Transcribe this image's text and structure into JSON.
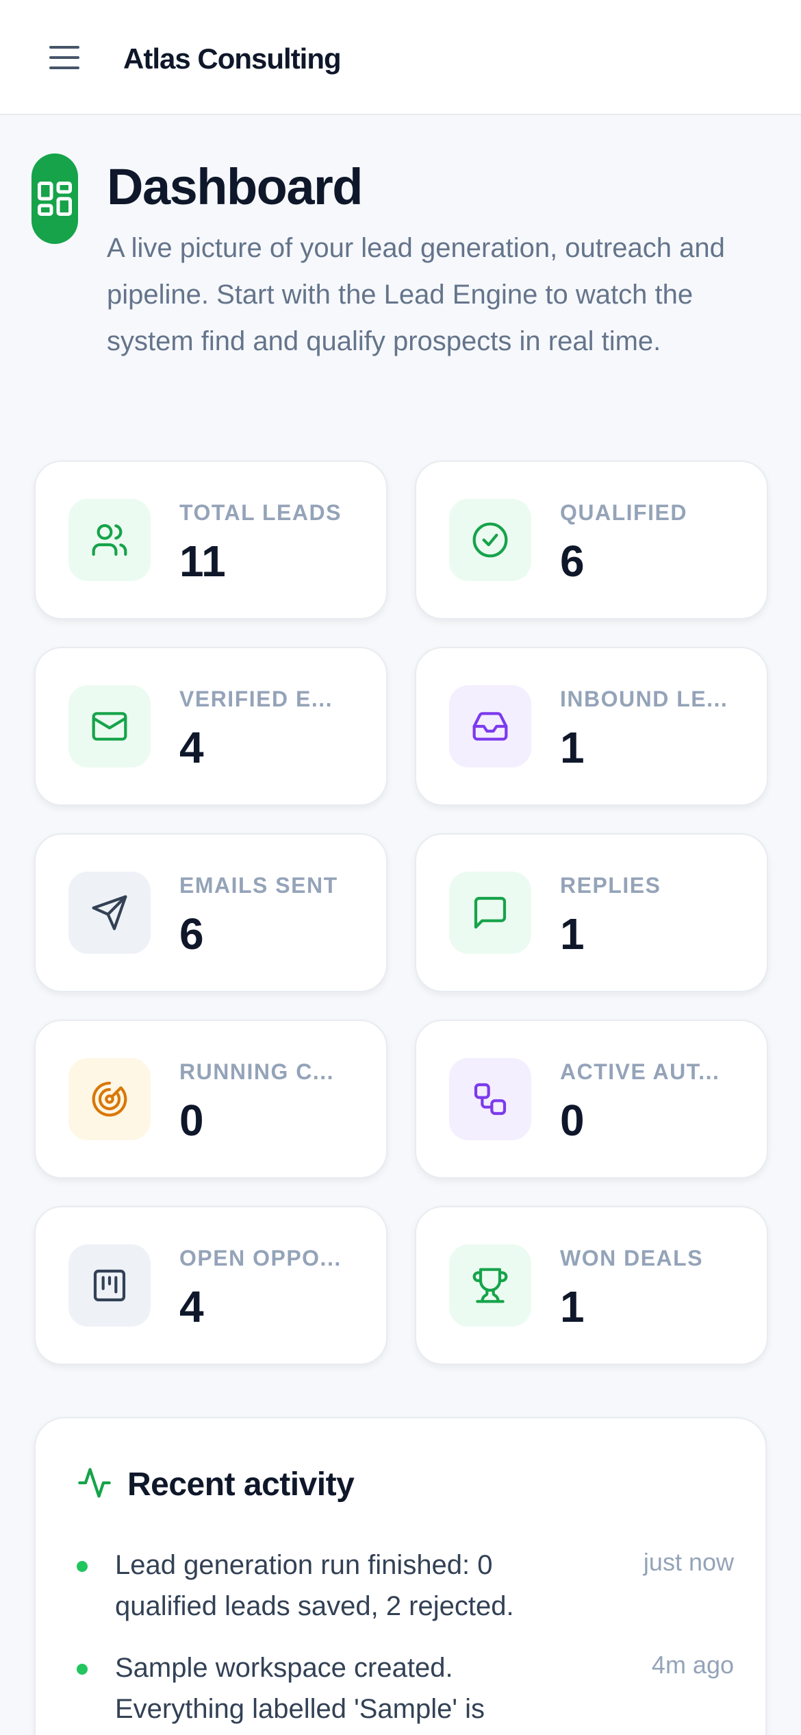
{
  "header": {
    "brand": "Atlas Consulting"
  },
  "page": {
    "title": "Dashboard",
    "description": "A live picture of your lead generation, outreach and pipeline. Start with the Lead Engine to watch the system find and qualify prospects in real time."
  },
  "stats": [
    {
      "label": "TOTAL LEADS",
      "value": "11",
      "icon": "users-icon",
      "accent": "#16a34a"
    },
    {
      "label": "QUALIFIED",
      "value": "6",
      "icon": "check-circle-icon",
      "accent": "#16a34a"
    },
    {
      "label": "VERIFIED E...",
      "value": "4",
      "icon": "mail-icon",
      "accent": "#16a34a"
    },
    {
      "label": "INBOUND LE...",
      "value": "1",
      "icon": "inbox-icon",
      "accent": "#7c3aed"
    },
    {
      "label": "EMAILS SENT",
      "value": "6",
      "icon": "send-icon",
      "accent": "#334155"
    },
    {
      "label": "REPLIES",
      "value": "1",
      "icon": "message-icon",
      "accent": "#16a34a"
    },
    {
      "label": "RUNNING C...",
      "value": "0",
      "icon": "radar-icon",
      "accent": "#d97706"
    },
    {
      "label": "ACTIVE AUT...",
      "value": "0",
      "icon": "workflow-icon",
      "accent": "#7c3aed"
    },
    {
      "label": "OPEN OPPO...",
      "value": "4",
      "icon": "kanban-icon",
      "accent": "#334155"
    },
    {
      "label": "WON DEALS",
      "value": "1",
      "icon": "trophy-icon",
      "accent": "#16a34a"
    }
  ],
  "activity": {
    "title": "Recent activity",
    "items": [
      {
        "text": "Lead generation run finished: 0 qualified leads saved, 2 rejected.",
        "time": "just now"
      },
      {
        "text": "Sample workspace created. Everything labelled 'Sample' is",
        "time": "4m ago"
      }
    ]
  },
  "colors": {
    "brand_green": "#16a34a",
    "background": "#f6f8fb"
  }
}
